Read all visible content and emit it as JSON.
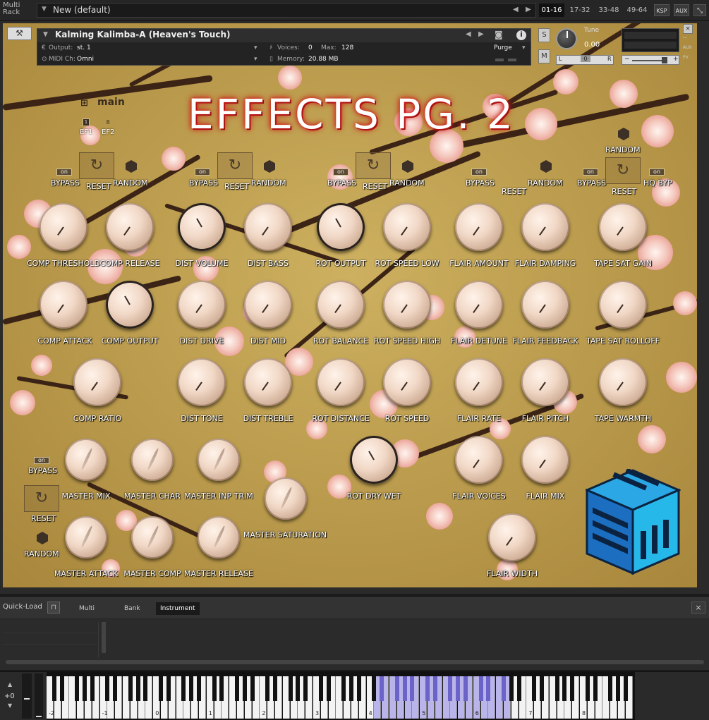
{
  "rack": {
    "title_line1": "Multi",
    "title_line2": "Rack",
    "preset": "New (default)",
    "tabs": [
      "01-16",
      "17-32",
      "33-48",
      "49-64"
    ],
    "selected_tab": "01-16",
    "ksp": "KSP",
    "aux": "AUX"
  },
  "instrument": {
    "name": "Kalming Kalimba-A (Heaven's Touch)",
    "output_label": "Output:",
    "output_value": "st. 1",
    "voices_label": "Voices:",
    "voices_value": "0",
    "max_label": "Max:",
    "max_value": "128",
    "purge": "Purge",
    "midi_label": "MIDI Ch:",
    "midi_value": "Omni",
    "memory_label": "Memory:",
    "memory_value": "20.88 MB",
    "tune_label": "Tune",
    "tune_value": "0.00",
    "solo": "S",
    "mute": "M",
    "pan_l": "L",
    "pan_c": "·0·",
    "pan_r": "R",
    "vol_minus": "−",
    "vol_plus": "+"
  },
  "page": {
    "title": "EFFECTS PG. 2",
    "nav_label": "main",
    "ef1": "EF1",
    "ef2": "EF2"
  },
  "sections": {
    "comp": {
      "bypass": "BYPASS",
      "reset": "RESET",
      "random": "RANDOM",
      "on": "on"
    },
    "dist": {
      "bypass": "BYPASS",
      "reset": "RESET",
      "random": "RANDOM",
      "on": "on"
    },
    "rot": {
      "bypass": "BYPASS",
      "reset": "RESET",
      "random": "RANDOM",
      "on": "on"
    },
    "flair": {
      "bypass": "BYPASS",
      "reset": "RESET",
      "random": "RANDOM",
      "on": "on"
    },
    "tape": {
      "bypass": "BYPASS",
      "reset": "RESET",
      "random": "RANDOM",
      "hq": "HQ BYP",
      "on": "on",
      "on2": "on"
    },
    "master": {
      "bypass": "BYPASS",
      "reset": "RESET",
      "random": "RANDOM",
      "on": "on"
    }
  },
  "knobs": {
    "comp_threshold": "COMP THRESHOLD",
    "comp_release": "COMP RELEASE",
    "comp_attack": "COMP ATTACK",
    "comp_output": "COMP OUTPUT",
    "comp_ratio": "COMP RATIO",
    "dist_volume": "DIST VOLUME",
    "dist_bass": "DIST BASS",
    "dist_drive": "DIST DRIVE",
    "dist_mid": "DIST MID",
    "dist_tone": "DIST TONE",
    "dist_treble": "DIST TREBLE",
    "rot_output": "ROT OUTPUT",
    "rot_speed_low": "ROT SPEED LOW",
    "rot_balance": "ROT BALANCE",
    "rot_speed_high": "ROT SPEED HIGH",
    "rot_distance": "ROT DISTANCE",
    "rot_speed": "ROT SPEED",
    "rot_dry_wet": "ROT DRY WET",
    "flair_amount": "FLAIR AMOUNT",
    "flair_damping": "FLAIR DAMPING",
    "flair_detune": "FLAIR DETUNE",
    "flair_feedback": "FLAIR FEEDBACK",
    "flair_rate": "FLAIR RATE",
    "flair_pitch": "FLAIR PITCH",
    "flair_voices": "FLAIR VOICES",
    "flair_mix": "FLAIR MIX",
    "flair_width": "FLAIR WIDTH",
    "tape_sat_gain": "TAPE SAT GAIN",
    "tape_sat_rolloff": "TAPE SAT ROLLOFF",
    "tape_warmth": "TAPE WARMTH",
    "master_mix": "MASTER MIX",
    "master_char": "MASTER CHAR",
    "master_inp_trim": "MASTER INP TRIM",
    "master_saturation": "MASTER SATURATION",
    "master_attack": "MASTER ATTACK",
    "master_comp": "MASTER COMP",
    "master_release": "MASTER RELEASE"
  },
  "quickload": {
    "label": "Quick-Load",
    "tabs": [
      "Multi",
      "Bank",
      "Instrument"
    ],
    "selected": "Instrument",
    "close": "×"
  },
  "keyboard": {
    "octave_shift": "+0",
    "octaves": [
      "-2",
      "-1",
      "0",
      "1",
      "2",
      "3",
      "4",
      "5",
      "6",
      "7",
      "8"
    ],
    "highlight_color": "#b9b4ea"
  }
}
